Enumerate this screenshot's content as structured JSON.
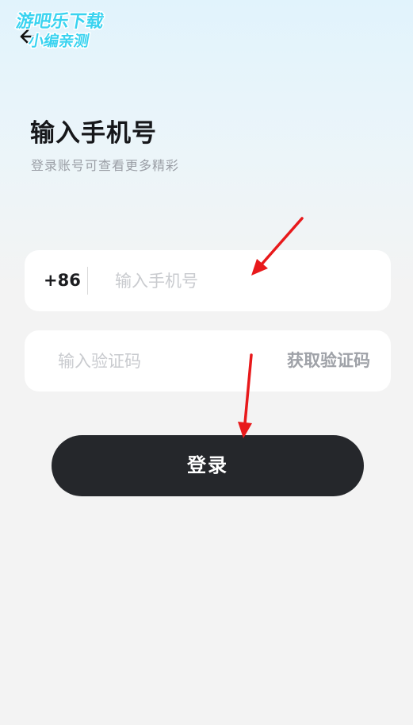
{
  "header": {
    "back_icon": "arrow-left-icon"
  },
  "watermark": {
    "line1": "游吧乐下载",
    "line2": "小编亲测"
  },
  "login": {
    "title": "输入手机号",
    "subtitle": "登录账号可查看更多精彩",
    "country_code": "+86",
    "phone_placeholder": "输入手机号",
    "phone_value": "",
    "code_placeholder": "输入验证码",
    "code_value": "",
    "get_code_label": "获取验证码",
    "submit_label": "登录"
  },
  "annotations": {
    "arrow_color": "#e8191b"
  },
  "colors": {
    "button_bg": "#25272b",
    "title": "#16171a",
    "muted": "#9a9ea5",
    "placeholder": "#c9cbcf"
  }
}
